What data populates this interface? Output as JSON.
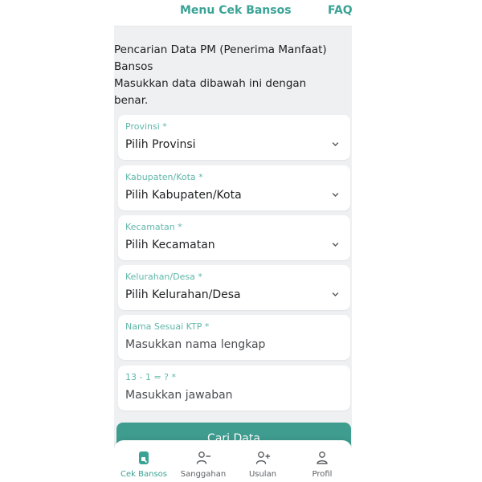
{
  "topnav": {
    "menu_label": "Menu Cek Bansos",
    "faq_label": "FAQ"
  },
  "intro": {
    "title_line1": "Pencarian Data PM (Penerima Manfaat)",
    "title_line2": "Bansos",
    "instruction_line1": "Masukkan data dibawah ini dengan",
    "instruction_line2": "benar."
  },
  "fields": [
    {
      "label": "Provinsi *",
      "value": "Pilih Provinsi",
      "type": "dropdown"
    },
    {
      "label": "Kabupaten/Kota *",
      "value": "Pilih Kabupaten/Kota",
      "type": "dropdown"
    },
    {
      "label": "Kecamatan *",
      "value": "Pilih Kecamatan",
      "type": "dropdown"
    },
    {
      "label": "Kelurahan/Desa *",
      "value": "Pilih Kelurahan/Desa",
      "type": "dropdown"
    },
    {
      "label": "Nama Sesuai KTP *",
      "placeholder": "Masukkan nama lengkap",
      "type": "text"
    },
    {
      "label": "13 - 1 = ? *",
      "placeholder": "Masukkan jawaban",
      "type": "text"
    }
  ],
  "submit_label": "Cari Data",
  "bottomnav": [
    {
      "label": "Cek Bansos",
      "icon": "document-icon",
      "active": true
    },
    {
      "label": "Sanggahan",
      "icon": "user-minus-icon",
      "active": false
    },
    {
      "label": "Usulan",
      "icon": "user-plus-icon",
      "active": false
    },
    {
      "label": "Profil",
      "icon": "user-icon",
      "active": false
    }
  ],
  "colors": {
    "accent": "#3aa395",
    "button": "#3f9d90",
    "background": "#eef0f2"
  }
}
